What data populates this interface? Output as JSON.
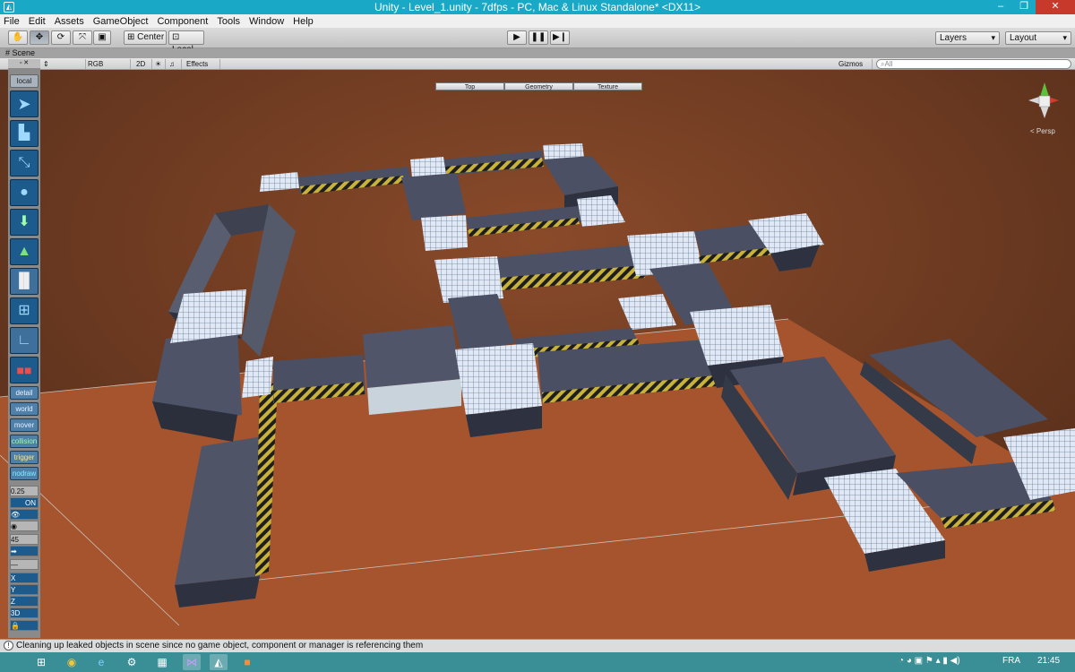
{
  "window": {
    "title": "Unity - Level_1.unity - 7dfps - PC, Mac & Linux Standalone* <DX11>"
  },
  "menu": [
    "File",
    "Edit",
    "Assets",
    "GameObject",
    "Component",
    "Tools",
    "Window",
    "Help"
  ],
  "toolbar": {
    "pivot_label": "Center",
    "space_label": "Local",
    "layers_label": "Layers",
    "layout_label": "Layout"
  },
  "scene": {
    "tab_label": "Scene",
    "render_mode": "RGB",
    "mode_2d": "2D",
    "effects_label": "Effects",
    "gizmos_label": "Gizmos",
    "search_placeholder": "All",
    "view_tabs": [
      "Top",
      "Geometry",
      "Texture"
    ],
    "persp_label": "Persp"
  },
  "palette": {
    "local_label": "local",
    "labels": [
      "detail",
      "world",
      "mover",
      "collision",
      "trigger",
      "nodraw"
    ],
    "grid_value": "0.25",
    "grid_state": "ON",
    "angle_value": "45",
    "axes": [
      "X",
      "Y",
      "Z",
      "3D"
    ]
  },
  "status": {
    "message": "Cleaning up leaked objects in scene since no game object, component or manager is referencing them"
  },
  "taskbar": {
    "language": "FRA",
    "time": "21:45"
  }
}
